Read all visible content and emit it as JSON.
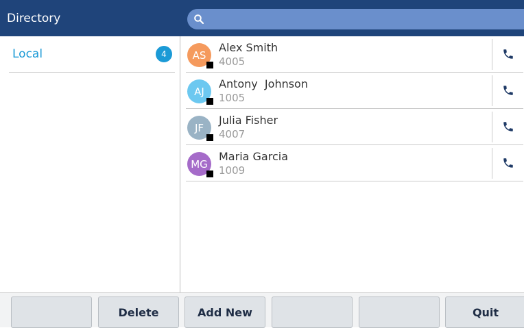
{
  "header": {
    "title": "Directory"
  },
  "search": {
    "value": "",
    "placeholder": ""
  },
  "sources": [
    {
      "label": "Local",
      "count": "4"
    }
  ],
  "contacts": [
    {
      "initials": "AS",
      "name": "Alex Smith",
      "extension": "4005",
      "avatar_color": "#f59a5d"
    },
    {
      "initials": "AJ",
      "name": "Antony  Johnson",
      "extension": "1005",
      "avatar_color": "#6cc8f0"
    },
    {
      "initials": "JF",
      "name": "Julia Fisher",
      "extension": "4007",
      "avatar_color": "#9ab3c5"
    },
    {
      "initials": "MG",
      "name": "Maria Garcia",
      "extension": "1009",
      "avatar_color": "#a56bc9"
    }
  ],
  "icons": {
    "search": "search-icon",
    "call": "phone-icon"
  },
  "softkeys": [
    "",
    "Delete",
    "Add New",
    "",
    "",
    "Quit"
  ],
  "colors": {
    "header": "#1f447a",
    "accent": "#1b9ad6",
    "search_bg": "#6a8fcc",
    "phone_icon": "#1f3a66"
  }
}
